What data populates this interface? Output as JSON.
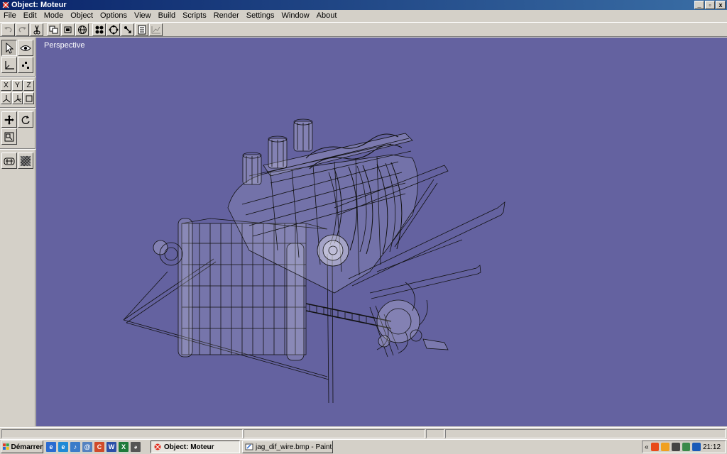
{
  "window": {
    "title": "Object: Moteur",
    "controls": [
      "_",
      "▫",
      "x"
    ]
  },
  "menu": [
    "File",
    "Edit",
    "Mode",
    "Object",
    "Options",
    "View",
    "Build",
    "Scripts",
    "Render",
    "Settings",
    "Window",
    "About"
  ],
  "toolbar": {
    "icons": [
      "undo-icon",
      "redo-icon",
      "cut-icon",
      "copy-object-icon",
      "paste-object-icon",
      "sphere-icon",
      "vertex-icon",
      "rotate-sphere-icon",
      "snap-icon",
      "list-icon",
      "graph-icon"
    ]
  },
  "left_panel": {
    "axes": [
      "X",
      "Y",
      "Z"
    ]
  },
  "viewport": {
    "label": "Perspective",
    "background": "#6462a0"
  },
  "taskbar": {
    "start_label": "Démarrer",
    "quick_launch": [
      {
        "name": "ie-icon",
        "text": "e",
        "color": "#2a6bd1"
      },
      {
        "name": "browser-icon",
        "text": "e",
        "color": "#1f8ad6"
      },
      {
        "name": "media-icon",
        "text": "♪",
        "color": "#3b7cc9"
      },
      {
        "name": "mail-icon",
        "text": "@",
        "color": "#5582c0"
      },
      {
        "name": "calendar-icon",
        "text": "C",
        "color": "#d04b2a"
      },
      {
        "name": "word-icon",
        "text": "W",
        "color": "#2b4fa8"
      },
      {
        "name": "excel-icon",
        "text": "X",
        "color": "#1e7a3a"
      },
      {
        "name": "panda-icon",
        "text": "◕",
        "color": "#555555"
      }
    ],
    "tasks": [
      {
        "label": "Object: Moteur",
        "active": true
      },
      {
        "label": "jag_dif_wire.bmp - Paint",
        "active": false
      }
    ],
    "tray_chevron": "«",
    "clock": "21:12"
  }
}
